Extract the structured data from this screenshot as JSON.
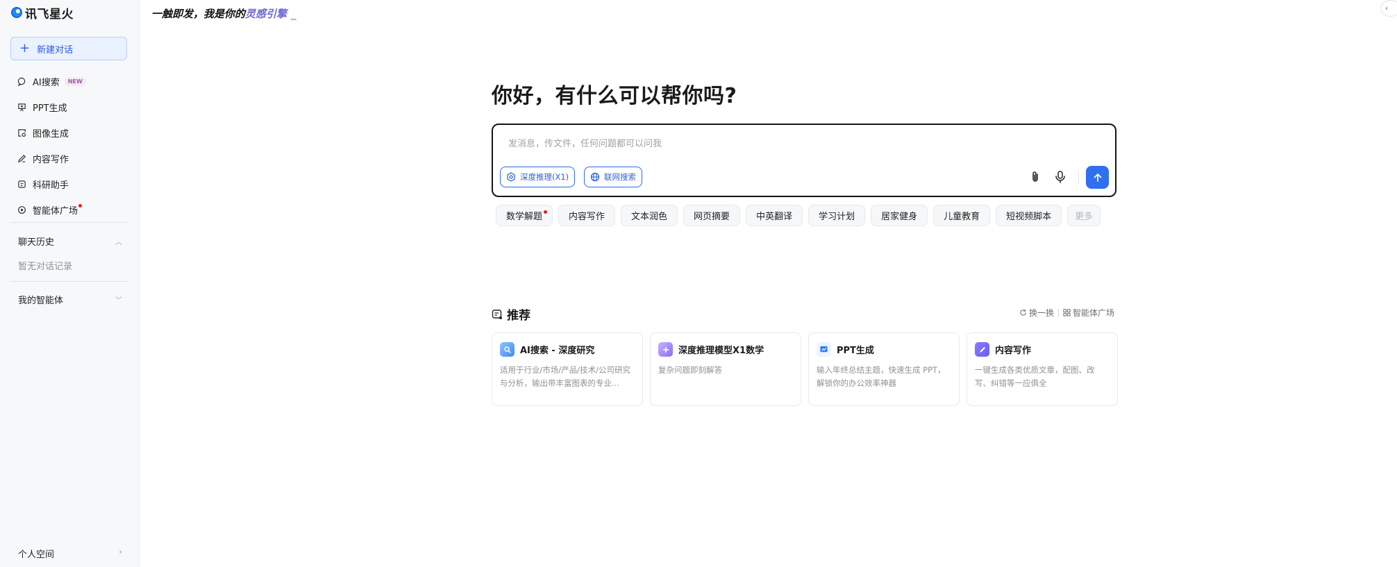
{
  "sidebar": {
    "logo_text": "讯飞星火",
    "new_chat_label": "新建对话",
    "nav_items": [
      {
        "label": "AI搜索",
        "icon": "search-bubble-icon",
        "badge": "NEW"
      },
      {
        "label": "PPT生成",
        "icon": "ppt-icon"
      },
      {
        "label": "图像生成",
        "icon": "image-icon"
      },
      {
        "label": "内容写作",
        "icon": "pen-icon"
      },
      {
        "label": "科研助手",
        "icon": "research-icon"
      },
      {
        "label": "智能体广场",
        "icon": "agent-icon",
        "notification_dot": true
      }
    ],
    "history_title": "聊天历史",
    "history_empty": "暂无对话记录",
    "my_agents_title": "我的智能体",
    "personal_space": "个人空间"
  },
  "slogan": {
    "prefix": "一触即发，我是你的",
    "highlight": "灵感引擎",
    "cursor": "_"
  },
  "main": {
    "greeting": "你好，有什么可以帮你吗?",
    "input_placeholder": "发消息，传文件，任何问题都可以问我",
    "deep_reasoning_label": "深度推理(X1)",
    "web_search_label": "联网搜索",
    "quick_actions": [
      "数学解题",
      "内容写作",
      "文本润色",
      "网页摘要",
      "中英翻译",
      "学习计划",
      "居家健身",
      "儿童教育",
      "短视频脚本"
    ],
    "quick_more": "更多",
    "recommend_title": "推荐",
    "refresh_label": "换一换",
    "agent_square_label": "智能体广场",
    "cards": [
      {
        "title": "AI搜索 - 深度研究",
        "desc": "适用于行业/市场/产品/技术/公司研究与分析，输出带丰富图表的专业...",
        "icon": "ai-search-icon",
        "color": "#3f8cf0"
      },
      {
        "title": "深度推理模型X1数学",
        "desc": "复杂问题即刻解答",
        "icon": "math-icon",
        "color": "#8e6cf2"
      },
      {
        "title": "PPT生成",
        "desc": "输入年终总结主题，快速生成 PPT，解锁你的办公效率神器",
        "icon": "ppt-chart-icon",
        "color": "#2f7df0"
      },
      {
        "title": "内容写作",
        "desc": "一键生成各类优质文章，配图、改写、纠错等一应俱全",
        "icon": "writing-icon",
        "color": "#6a5cf0"
      }
    ]
  },
  "colors": {
    "accent": "#2f6ff0",
    "notification": "#ee1c1c",
    "slogan_highlight": "#7068d6"
  }
}
